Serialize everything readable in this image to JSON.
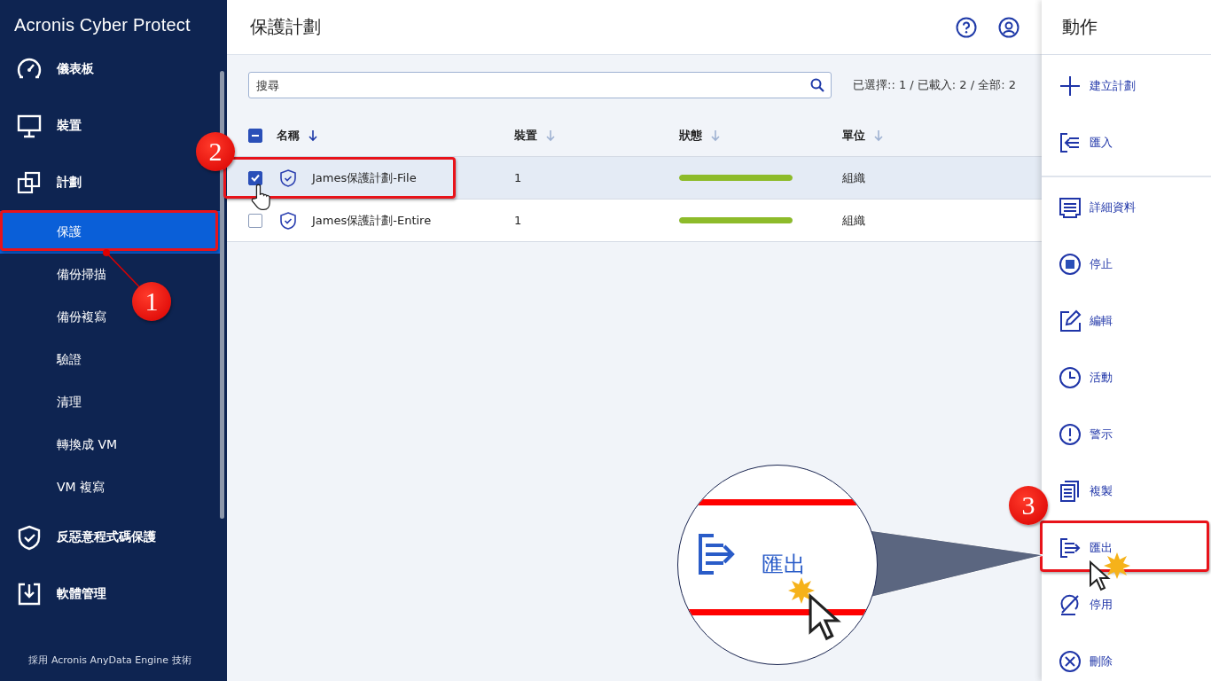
{
  "sidebar": {
    "logo": "Acronis Cyber Protect",
    "items": [
      {
        "label": "儀表板",
        "selected": false
      },
      {
        "label": "裝置",
        "selected": false
      },
      {
        "label": "計劃",
        "selected": false,
        "children": [
          {
            "label": "保護",
            "selected": true
          },
          {
            "label": "備份掃描",
            "selected": false
          },
          {
            "label": "備份複寫",
            "selected": false
          },
          {
            "label": "驗證",
            "selected": false
          },
          {
            "label": "清理",
            "selected": false
          },
          {
            "label": "轉換成 VM",
            "selected": false
          },
          {
            "label": "VM 複寫",
            "selected": false
          }
        ]
      },
      {
        "label": "反惡意程式碼保護",
        "selected": false
      },
      {
        "label": "軟體管理",
        "selected": false
      }
    ],
    "footer": "採用 Acronis AnyData Engine 技術"
  },
  "header": {
    "title": "保護計劃"
  },
  "toolbar": {
    "search": {
      "placeholder": "搜尋"
    },
    "counts": "已選擇:: 1 / 已載入: 2 / 全部: 2"
  },
  "table": {
    "select_all": {
      "indeterminate": true
    },
    "columns": [
      {
        "label": "名稱",
        "sorted": true
      },
      {
        "label": "裝置",
        "sorted": false
      },
      {
        "label": "狀態",
        "sorted": false
      },
      {
        "label": "單位",
        "sorted": false
      }
    ],
    "rows": [
      {
        "selected": true,
        "checked": true,
        "name": "James保護計劃-File",
        "devices": "1",
        "level": 1,
        "unit": "組織"
      },
      {
        "selected": false,
        "checked": false,
        "name": "James保護計劃-Entire",
        "devices": "1",
        "level": 1,
        "unit": "組織"
      }
    ]
  },
  "actions": {
    "title": "動作",
    "groups": [
      {
        "items": [
          {
            "label": "建立計劃"
          },
          {
            "label": "匯入"
          }
        ]
      },
      {
        "items": [
          {
            "label": "詳細資料"
          },
          {
            "label": "停止"
          },
          {
            "label": "編輯"
          },
          {
            "label": "活動"
          },
          {
            "label": "警示"
          },
          {
            "label": "複製"
          },
          {
            "label": "匯出"
          },
          {
            "label": "停用"
          },
          {
            "label": "刪除"
          }
        ]
      }
    ]
  },
  "annotations": {
    "markers": [
      "1",
      "2",
      "3"
    ],
    "magnifier": {
      "label": "匯出"
    }
  }
}
